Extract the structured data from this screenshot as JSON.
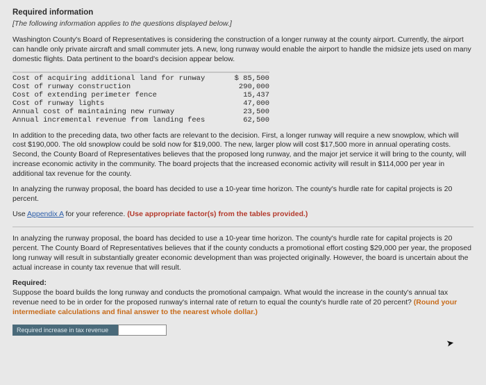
{
  "title": "Required information",
  "subtitle": "[The following information applies to the questions displayed below.]",
  "intro": "Washington County's Board of Representatives is considering the construction of a longer runway at the county airport. Currently, the airport can handle only private aircraft and small commuter jets. A new, long runway would enable the airport to handle the midsize jets used on many domestic flights. Data pertinent to the board's decision appear below.",
  "costs": [
    {
      "label": "Cost of acquiring additional land for runway",
      "value": "$ 85,500"
    },
    {
      "label": "Cost of runway construction",
      "value": "290,000"
    },
    {
      "label": "Cost of extending perimeter fence",
      "value": "15,437"
    },
    {
      "label": "Cost of runway lights",
      "value": "47,000"
    },
    {
      "label": "Annual cost of maintaining new runway",
      "value": "23,500"
    },
    {
      "label": "Annual incremental revenue from landing fees",
      "value": "62,500"
    }
  ],
  "para1": "In addition to the preceding data, two other facts are relevant to the decision. First, a longer runway will require a new snowplow, which will cost $190,000. The old snowplow could be sold now for $19,000. The new, larger plow will cost $17,500 more in annual operating costs. Second, the County Board of Representatives believes that the proposed long runway, and the major jet service it will bring to the county, will increase economic activity in the community. The board projects that the increased economic activity will result in $114,000 per year in additional tax revenue for the county.",
  "para2": "In analyzing the runway proposal, the board has decided to use a 10-year time horizon. The county's hurdle rate for capital projects is 20 percent.",
  "appendix_prefix": "Use ",
  "appendix_link": "Appendix A",
  "appendix_mid": " for your reference. ",
  "appendix_bold": "(Use appropriate factor(s) from the tables provided.)",
  "para3": "In analyzing the runway proposal, the board has decided to use a 10-year time horizon. The county's hurdle rate for capital projects is 20 percent. The County Board of Representatives believes that if the county conducts a promotional effort costing $29,000 per year, the proposed long runway will result in substantially greater economic development than was projected originally. However, the board is uncertain about the actual increase in county tax revenue that will result.",
  "required_label": "Required:",
  "required_text": "Suppose the board builds the long runway and conducts the promotional campaign. What would the increase in the county's annual tax revenue need to be in order for the proposed runway's internal rate of return to equal the county's hurdle rate of 20 percent? ",
  "required_note": "(Round your intermediate calculations and final answer to the nearest whole dollar.)",
  "answer_label": "Required increase in tax revenue",
  "answer_value": ""
}
